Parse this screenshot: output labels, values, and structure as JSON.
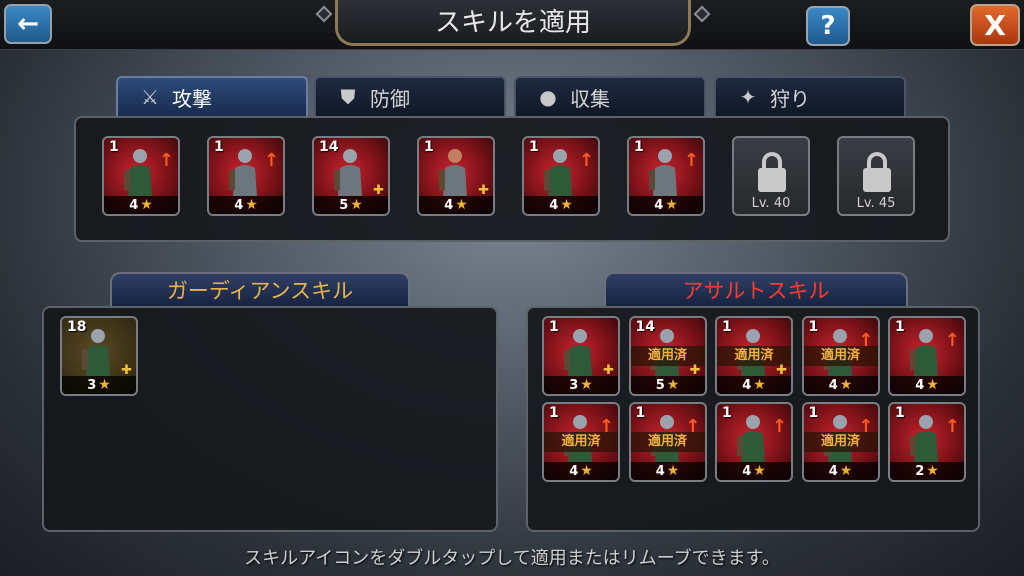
{
  "header": {
    "title": "スキルを適用",
    "back_icon": "←",
    "help_label": "?",
    "close_label": "X"
  },
  "tabs": [
    {
      "label": "攻撃",
      "icon": "crossed-swords",
      "glyph": "⚔",
      "active": true
    },
    {
      "label": "防御",
      "icon": "shield",
      "glyph": "⛊",
      "active": false
    },
    {
      "label": "収集",
      "icon": "drop",
      "glyph": "●",
      "active": false
    },
    {
      "label": "狩り",
      "icon": "beast",
      "glyph": "✦",
      "active": false
    }
  ],
  "skill_row": [
    {
      "level": "1",
      "stars": "4",
      "arrow": true,
      "plus": false,
      "type": "archer"
    },
    {
      "level": "1",
      "stars": "4",
      "arrow": true,
      "plus": false,
      "type": "cavalry"
    },
    {
      "level": "14",
      "stars": "5",
      "arrow": false,
      "plus": true,
      "type": "infantry"
    },
    {
      "level": "1",
      "stars": "4",
      "arrow": false,
      "plus": true,
      "type": "hero"
    },
    {
      "level": "1",
      "stars": "4",
      "arrow": true,
      "plus": false,
      "type": "archer"
    },
    {
      "level": "1",
      "stars": "4",
      "arrow": true,
      "plus": false,
      "type": "cavalry"
    },
    {
      "locked": true,
      "lock_label": "Lv. 40"
    },
    {
      "locked": true,
      "lock_label": "Lv. 45"
    }
  ],
  "guardian": {
    "title": "ガーディアンスキル",
    "cards": [
      {
        "level": "18",
        "stars": "3",
        "plus": true
      }
    ]
  },
  "assault": {
    "title": "アサルトスキル",
    "cards": [
      {
        "level": "1",
        "stars": "3",
        "applied": "",
        "arrow": false,
        "plus": true
      },
      {
        "level": "14",
        "stars": "5",
        "applied": "適用済",
        "arrow": false,
        "plus": true
      },
      {
        "level": "1",
        "stars": "4",
        "applied": "適用済",
        "arrow": false,
        "plus": true
      },
      {
        "level": "1",
        "stars": "4",
        "applied": "適用済",
        "arrow": true,
        "plus": false
      },
      {
        "level": "1",
        "stars": "4",
        "applied": "",
        "arrow": true,
        "plus": false
      },
      {
        "level": "1",
        "stars": "4",
        "applied": "適用済",
        "arrow": true,
        "plus": false
      },
      {
        "level": "1",
        "stars": "4",
        "applied": "適用済",
        "arrow": true,
        "plus": false
      },
      {
        "level": "1",
        "stars": "4",
        "applied": "",
        "arrow": true,
        "plus": false
      },
      {
        "level": "1",
        "stars": "4",
        "applied": "適用済",
        "arrow": true,
        "plus": false
      },
      {
        "level": "1",
        "stars": "2",
        "applied": "",
        "arrow": true,
        "plus": false
      }
    ]
  },
  "hint": "スキルアイコンをダブルタップして適用またはリムーブできます。"
}
